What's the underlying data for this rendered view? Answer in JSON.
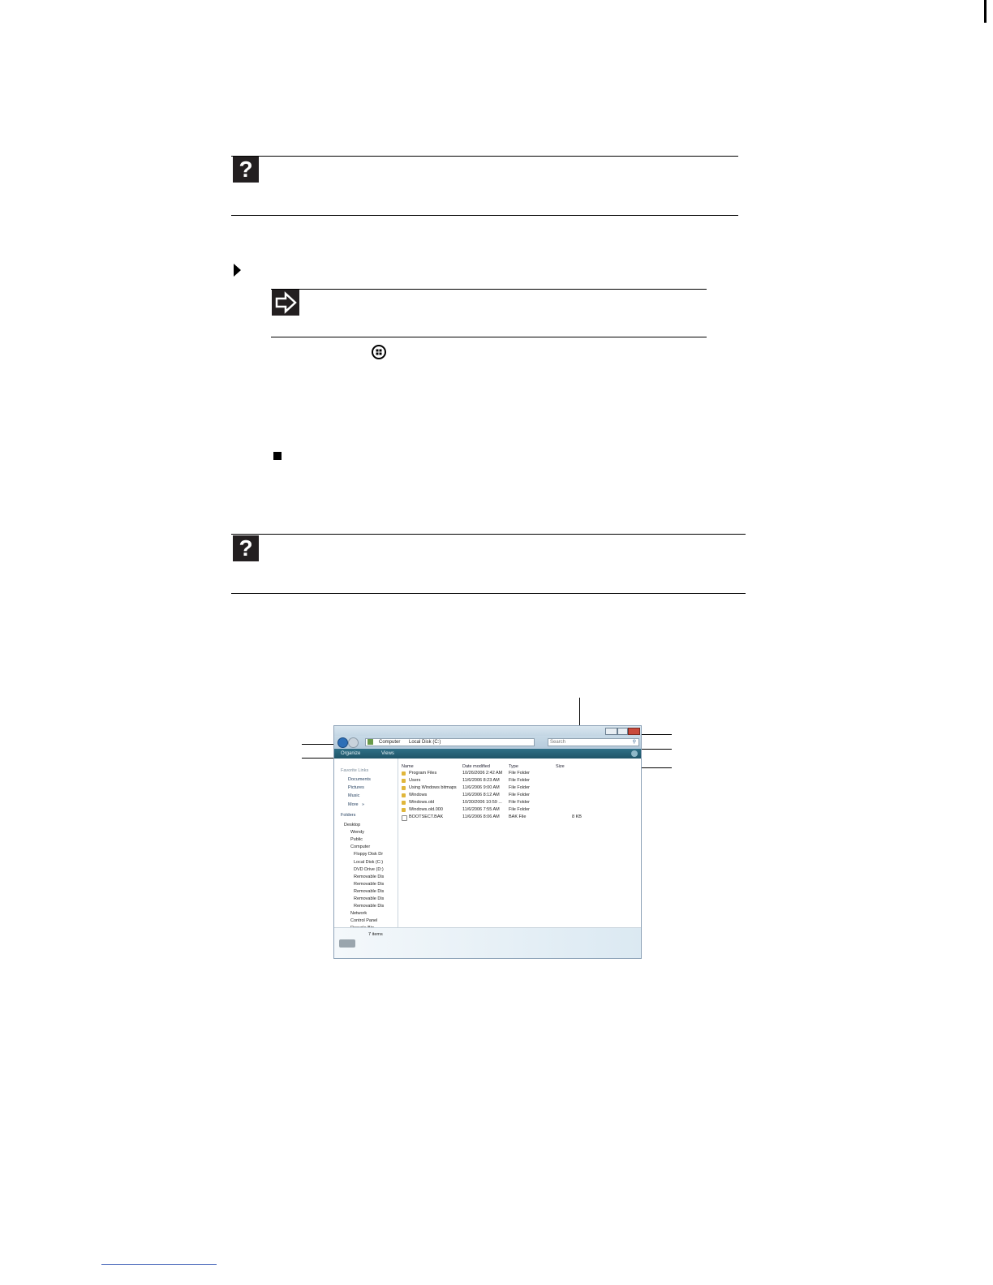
{
  "window": {
    "address_path": [
      "Computer",
      "Local Disk (C:)"
    ],
    "search_placeholder": "Search",
    "toolbar": {
      "organize": "Organize",
      "views": "Views"
    },
    "nav": {
      "favorite_links_header": "Favorite Links",
      "favorite_links": [
        "Documents",
        "Pictures",
        "Music"
      ],
      "more": "More",
      "more_glyph": "»",
      "folders_header": "Folders",
      "tree": [
        "Desktop",
        "Wendy",
        "Public",
        "Computer",
        "Floppy Disk Dr",
        "Local Disk (C:)",
        "DVD Drive (D:)",
        "Removable Dis",
        "Removable Dis",
        "Removable Dis",
        "Removable Dis",
        "Removable Dis",
        "Network",
        "Control Panel",
        "Recycle Bin"
      ]
    },
    "columns": [
      "Name",
      "Date modified",
      "Type",
      "Size"
    ],
    "files": [
      {
        "name": "Program Files",
        "date": "10/26/2006 2:42 AM",
        "type": "File Folder",
        "size": ""
      },
      {
        "name": "Users",
        "date": "11/6/2006 8:23 AM",
        "type": "File Folder",
        "size": ""
      },
      {
        "name": "Using Windows bitmaps",
        "date": "11/6/2006 9:00 AM",
        "type": "File Folder",
        "size": ""
      },
      {
        "name": "Windows",
        "date": "11/6/2006 8:12 AM",
        "type": "File Folder",
        "size": ""
      },
      {
        "name": "Windows.old",
        "date": "10/30/2006 10:59 ...",
        "type": "File Folder",
        "size": ""
      },
      {
        "name": "Windows.old.000",
        "date": "11/6/2006 7:55 AM",
        "type": "File Folder",
        "size": ""
      },
      {
        "name": "BOOTSECT.BAK",
        "date": "11/6/2006 8:06 AM",
        "type": "BAK File",
        "size": "8 KB"
      }
    ],
    "status": "7 items"
  },
  "icons": {
    "help": "question-mark",
    "note": "arrow-right",
    "step": "triangle-right",
    "end": "square",
    "start_button": "windows-start-orb"
  },
  "colors": {
    "toolbar": "#1f5568",
    "close_button": "#c94a3c",
    "footer_line": "#3a5bb5"
  }
}
